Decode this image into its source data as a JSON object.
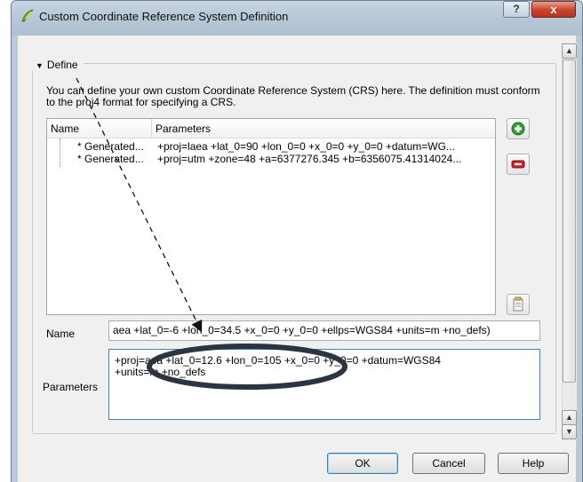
{
  "window": {
    "title": "Custom Coordinate Reference System Definition",
    "help_glyph": "?",
    "close_glyph": "x"
  },
  "define_group": {
    "legend": "Define",
    "description": "You can define your own custom Coordinate Reference System (CRS) here. The definition must conform to the proj4 format for specifying a CRS."
  },
  "table": {
    "headers": [
      "Name",
      "Parameters"
    ],
    "rows": [
      {
        "name": "* Generated...",
        "parameters": "+proj=laea +lat_0=90 +lon_0=0 +x_0=0 +y_0=0 +datum=WG..."
      },
      {
        "name": "* Generated...",
        "parameters": "+proj=utm +zone=48 +a=6377276.345 +b=6356075.41314024..."
      }
    ]
  },
  "name_field": {
    "label": "Name",
    "value": "aea +lat_0=-6 +lon_0=34.5 +x_0=0 +y_0=0 +ellps=WGS84 +units=m +no_defs)"
  },
  "parameters_field": {
    "label": "Parameters",
    "value": "+proj=aea +lat_0=12.6 +lon_0=105 +x_0=0 +y_0=0 +datum=WGS84\n+units=m +no_defs"
  },
  "buttons": {
    "ok": "OK",
    "cancel": "Cancel",
    "help": "Help"
  },
  "colors": {
    "accent_border": "#3d86c6",
    "add_icon": "#2e9e2e",
    "remove_icon": "#cc1f1f",
    "annotation": "#2b3442"
  },
  "icons": {
    "app": "qgis-icon",
    "add": "add-crs-icon",
    "remove": "remove-crs-icon",
    "copy": "copy-crs-icon"
  }
}
